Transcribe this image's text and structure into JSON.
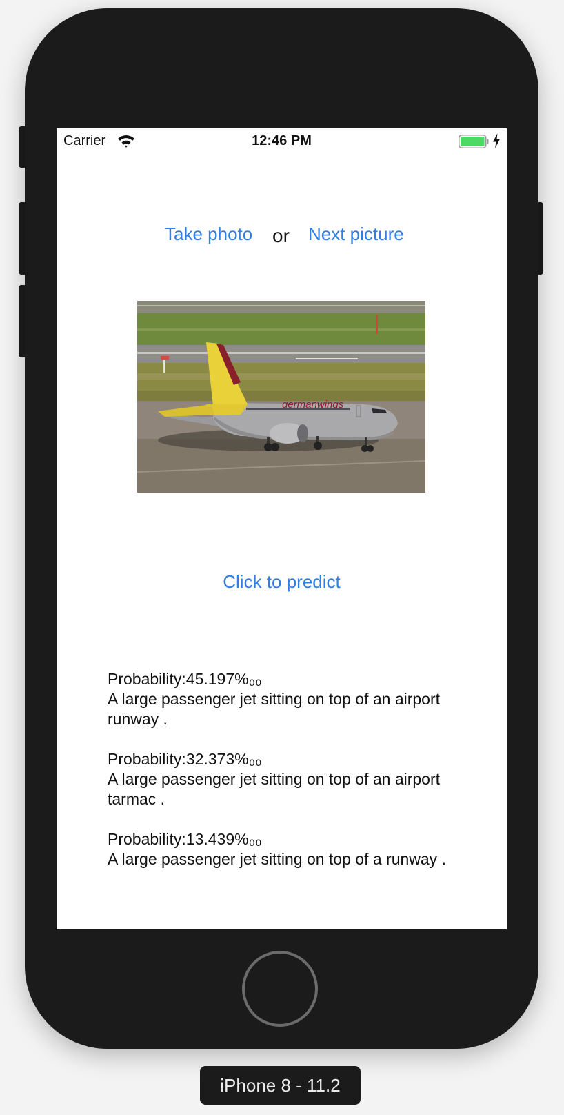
{
  "status_bar": {
    "carrier": "Carrier",
    "time": "12:46 PM",
    "battery_color": "#4cd964"
  },
  "actions": {
    "take_photo": "Take photo",
    "or": "or",
    "next_picture": "Next picture",
    "predict": "Click to predict"
  },
  "photo": {
    "airline_text": "germanwings"
  },
  "results": [
    {
      "probability": "Probability:45.197%₀₀",
      "caption": " A large passenger jet sitting on top of an airport runway ."
    },
    {
      "probability": "Probability:32.373%₀₀",
      "caption": " A large passenger jet sitting on top of an airport tarmac ."
    },
    {
      "probability": "Probability:13.439%₀₀",
      "caption": " A large passenger jet sitting on top of a runway ."
    }
  ],
  "device": {
    "label": "iPhone 8 - 11.2"
  },
  "colors": {
    "accent": "#2f7fe7",
    "device_body": "#1b1b1b"
  },
  "icons": [
    "wifi-icon",
    "battery-icon",
    "charging-bolt-icon",
    "home-button"
  ]
}
